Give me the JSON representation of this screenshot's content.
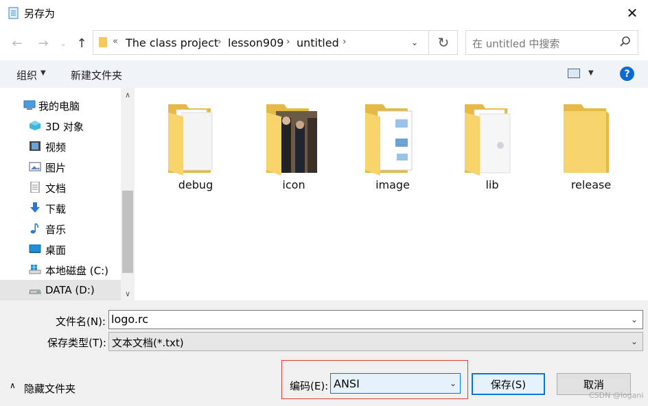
{
  "window": {
    "title": "另存为"
  },
  "address": {
    "prefix": "«",
    "crumbs": [
      "The class project",
      "lesson909",
      "untitled"
    ],
    "separator": "›"
  },
  "search": {
    "placeholder": "在 untitled 中搜索"
  },
  "toolbar": {
    "organize": "组织",
    "new_folder": "新建文件夹",
    "help": "?"
  },
  "sidebar": {
    "items": [
      {
        "label": "我的电脑",
        "icon": "computer-icon"
      },
      {
        "label": "3D 对象",
        "icon": "cube-3d-icon"
      },
      {
        "label": "视频",
        "icon": "video-icon"
      },
      {
        "label": "图片",
        "icon": "picture-icon"
      },
      {
        "label": "文档",
        "icon": "document-icon"
      },
      {
        "label": "下载",
        "icon": "download-arrow-icon"
      },
      {
        "label": "音乐",
        "icon": "music-note-icon"
      },
      {
        "label": "桌面",
        "icon": "desktop-icon"
      },
      {
        "label": "本地磁盘 (C:)",
        "icon": "windows-drive-icon"
      },
      {
        "label": "DATA (D:)",
        "icon": "drive-icon"
      }
    ]
  },
  "folders": [
    {
      "name": "debug",
      "icon": "folder-documents-icon"
    },
    {
      "name": "icon",
      "icon": "folder-photo-icon"
    },
    {
      "name": "image",
      "icon": "folder-image-icon"
    },
    {
      "name": "lib",
      "icon": "folder-files-icon"
    },
    {
      "name": "release",
      "icon": "folder-empty-icon"
    }
  ],
  "form": {
    "filename_label": "文件名(N):",
    "filename_value": "logo.rc",
    "filetype_label": "保存类型(T):",
    "filetype_value": "文本文档(*.txt)",
    "hide_folders": "隐藏文件夹",
    "encoding_label": "编码(E):",
    "encoding_value": "ANSI",
    "save": "保存(S)",
    "cancel": "取消"
  },
  "watermark": "CSDN @logani",
  "colors": {
    "accent": "#0078d7",
    "highlight": "#e53935",
    "folder": "#f5c95a"
  }
}
